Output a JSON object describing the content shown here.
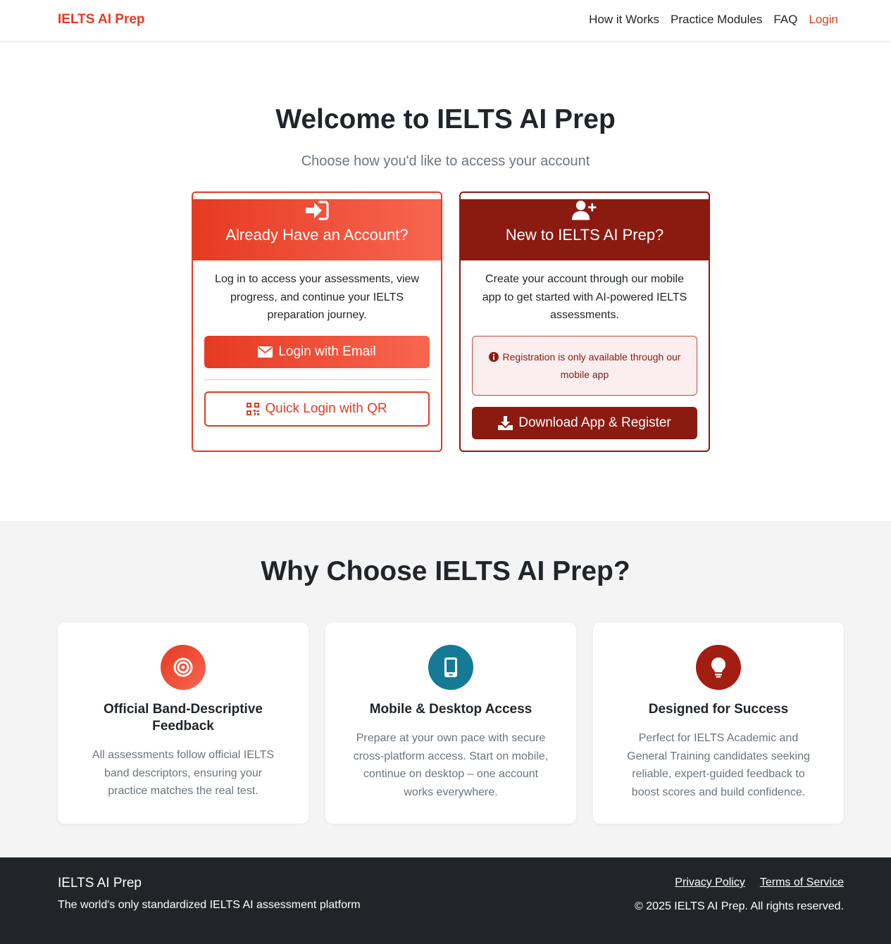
{
  "nav": {
    "brand": "IELTS AI Prep",
    "links": [
      "How it Works",
      "Practice Modules",
      "FAQ"
    ],
    "login": "Login"
  },
  "hero": {
    "title": "Welcome to IELTS AI Prep",
    "subtitle": "Choose how you'd like to access your account"
  },
  "login_card": {
    "icon": "sign-in-icon",
    "title": "Already Have an Account?",
    "text": "Log in to access your assessments, view progress, and continue your IELTS preparation journey.",
    "email_button": "Login with Email",
    "qr_button": "Quick Login with QR"
  },
  "register_card": {
    "icon": "user-plus-icon",
    "title": "New to IELTS AI Prep?",
    "text": "Create your account through our mobile app to get started with AI-powered IELTS assessments.",
    "alert": "Registration is only available through our mobile app",
    "download_button": "Download App & Register"
  },
  "why": {
    "title": "Why Choose IELTS AI Prep?",
    "features": [
      {
        "icon": "target-icon",
        "title": "Official Band-Descriptive Feedback",
        "text": "All assessments follow official IELTS band descriptors, ensuring your practice matches the real test."
      },
      {
        "icon": "mobile-icon",
        "title": "Mobile & Desktop Access",
        "text": "Prepare at your own pace with secure cross-platform access. Start on mobile, continue on desktop – one account works everywhere."
      },
      {
        "icon": "lightbulb-icon",
        "title": "Designed for Success",
        "text": "Perfect for IELTS Academic and General Training candidates seeking reliable, expert-guided feedback to boost scores and build confidence."
      }
    ]
  },
  "footer": {
    "brand": "IELTS AI Prep",
    "tagline": "The world's only standardized IELTS AI assessment platform",
    "privacy": "Privacy Policy",
    "terms": "Terms of Service",
    "copyright": "© 2025 IELTS AI Prep. All rights reserved."
  },
  "colors": {
    "primary": "#e63a22",
    "dark_red": "#8b1a10",
    "teal": "#147a96",
    "footer_bg": "#212529"
  }
}
